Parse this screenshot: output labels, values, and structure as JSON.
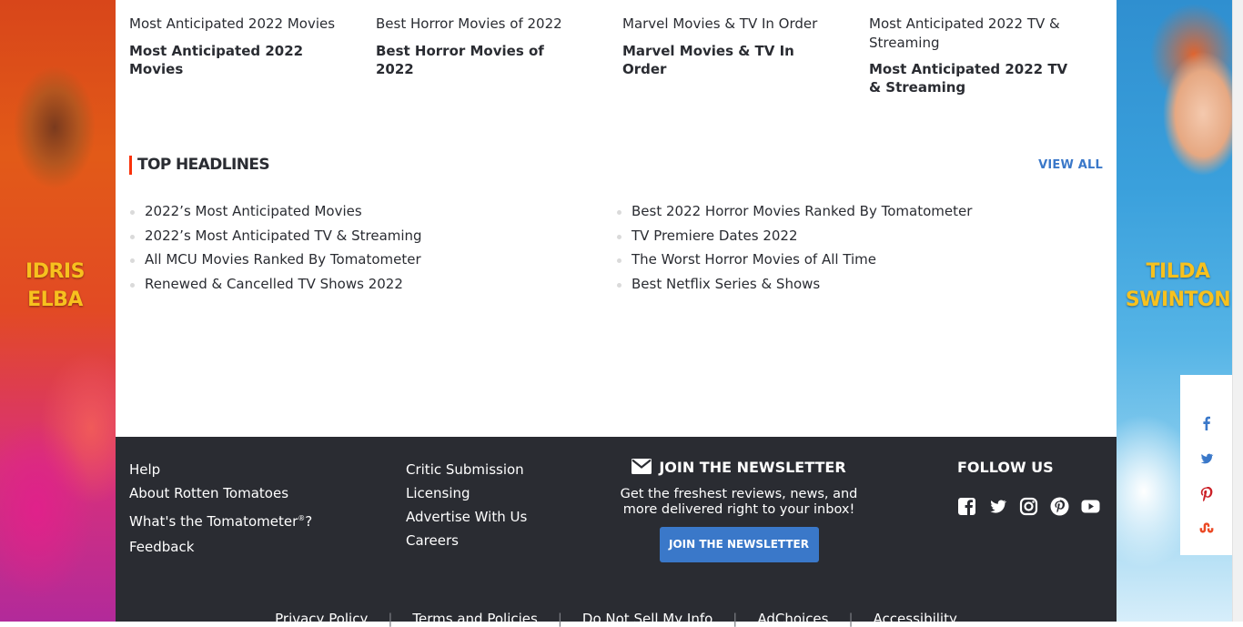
{
  "ads": {
    "left_name": [
      "IDRIS",
      "ELBA"
    ],
    "right_name": [
      "TILDA",
      "SWINTON"
    ]
  },
  "guides": [
    {
      "link": "Most Anticipated 2022 Movies",
      "title": "Most Anticipated 2022 Movies"
    },
    {
      "link": "Best Horror Movies of 2022",
      "title": "Best Horror Movies of 2022"
    },
    {
      "link": "Marvel Movies & TV In Order",
      "title": "Marvel Movies & TV In Order"
    },
    {
      "link": "Most Anticipated 2022 TV & Streaming",
      "title": "Most Anticipated 2022 TV & Streaming"
    }
  ],
  "headlines": {
    "title": "Top Headlines",
    "view_all": "VIEW ALL",
    "left": [
      "2022’s Most Anticipated Movies",
      "2022’s Most Anticipated TV & Streaming",
      "All MCU Movies Ranked By Tomatometer",
      "Renewed & Cancelled TV Shows 2022"
    ],
    "right": [
      "Best 2022 Horror Movies Ranked By Tomatometer",
      "TV Premiere Dates 2022",
      "The Worst Horror Movies of All Time",
      "Best Netflix Series & Shows"
    ]
  },
  "footer": {
    "col1": [
      "Help",
      "About Rotten Tomatoes",
      "What's the Tomatometer",
      "Feedback"
    ],
    "tomatometer_suffix": "?",
    "registered": "®",
    "col2": [
      "Critic Submission",
      "Licensing",
      "Advertise With Us",
      "Careers"
    ],
    "newsletter": {
      "heading": "JOIN THE NEWSLETTER",
      "text": "Get the freshest reviews, news, and more delivered right to your inbox!",
      "button": "JOIN THE NEWSLETTER"
    },
    "follow": {
      "heading": "FOLLOW US",
      "icons": [
        "facebook-icon",
        "twitter-icon",
        "instagram-icon",
        "pinterest-icon",
        "youtube-icon"
      ]
    },
    "legal": [
      "Privacy Policy",
      "Terms and Policies",
      "Do Not Sell My Info",
      "AdChoices",
      "Accessibility"
    ]
  },
  "share": {
    "icons": [
      "facebook-icon",
      "twitter-icon",
      "pinterest-icon",
      "stumbleupon-icon"
    ],
    "colors": {
      "active": "#3a78c9",
      "pinterest": "#cb2027",
      "stumbleupon": "#eb4924"
    }
  },
  "colors": {
    "accent": "#fa320a",
    "link_blue": "#3a78c9",
    "footer_bg": "#2a2c32",
    "ad_text": "#f7c11e"
  }
}
